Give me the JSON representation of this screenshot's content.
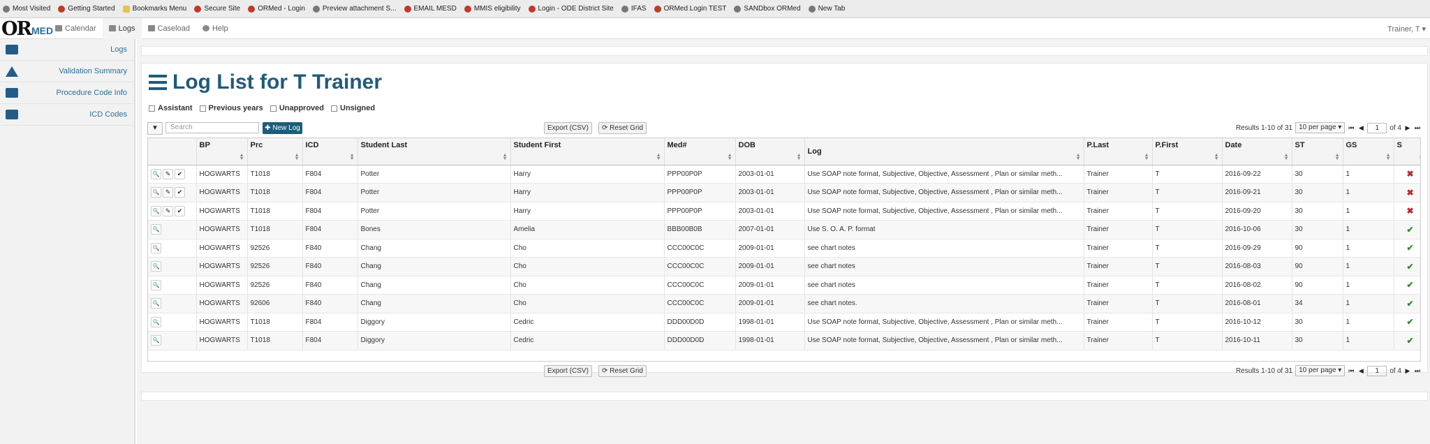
{
  "bookmarks": [
    {
      "label": "Most Visited",
      "icon": "gear-icon"
    },
    {
      "label": "Getting Started",
      "icon": "firefox-icon"
    },
    {
      "label": "Bookmarks Menu",
      "icon": "folder-icon"
    },
    {
      "label": "Secure Site",
      "icon": "site-icon"
    },
    {
      "label": "ORMed - Login",
      "icon": "site-icon"
    },
    {
      "label": "Preview attachment S...",
      "icon": "globe-icon"
    },
    {
      "label": "EMAIL MESD",
      "icon": "site-icon"
    },
    {
      "label": "MMIS eligibility",
      "icon": "site-icon"
    },
    {
      "label": "Login - ODE District Site",
      "icon": "site-icon"
    },
    {
      "label": "IFAS",
      "icon": "globe-icon"
    },
    {
      "label": "ORMed Login TEST",
      "icon": "site-icon"
    },
    {
      "label": "SANDbox ORMed",
      "icon": "globe-icon"
    },
    {
      "label": "New Tab",
      "icon": "globe-icon"
    }
  ],
  "nav": {
    "logo_or": "OR",
    "logo_med": "MED",
    "calendar": "Calendar",
    "logs": "Logs",
    "caseload": "Caseload",
    "help": "Help",
    "user": "Trainer, T ▾"
  },
  "sidebar": {
    "items": [
      {
        "label": "Logs",
        "icon": "list-icon"
      },
      {
        "label": "Validation Summary",
        "icon": "warning-icon"
      },
      {
        "label": "Procedure Code Info",
        "icon": "stack-icon"
      },
      {
        "label": "ICD Codes",
        "icon": "card-icon"
      }
    ]
  },
  "page": {
    "title": "Log List for T Trainer",
    "filters": [
      "Assistant",
      "Previous years",
      "Unapproved",
      "Unsigned"
    ],
    "search_placeholder": "Search",
    "new_log": "✚ New Log",
    "export": "Export (CSV)",
    "reset": "⟳ Reset Grid",
    "results": "Results 1-10  of 31",
    "per_page": "10 per page ▾",
    "page_num": "1",
    "of_pages": "of 4"
  },
  "table": {
    "columns": [
      "",
      "BP",
      "Prc",
      "ICD",
      "Student Last",
      "Student First",
      "Med#",
      "DOB",
      "Log",
      "P.Last",
      "P.First",
      "Date",
      "ST",
      "GS",
      "S"
    ],
    "rows": [
      {
        "actions": 3,
        "bp": "HOGWARTS",
        "prc": "T1018",
        "icd": "F804",
        "last": "Potter",
        "first": "Harry",
        "med": "PPP00P0P",
        "dob": "2003-01-01",
        "log": "Use SOAP note format, Subjective, Objective, Assessment , Plan or similar meth...",
        "plast": "Trainer",
        "pfirst": "T",
        "date": "2016-09-22",
        "st": "30",
        "gs": "1",
        "s": "x"
      },
      {
        "actions": 3,
        "bp": "HOGWARTS",
        "prc": "T1018",
        "icd": "F804",
        "last": "Potter",
        "first": "Harry",
        "med": "PPP00P0P",
        "dob": "2003-01-01",
        "log": "Use SOAP note format, Subjective, Objective, Assessment , Plan or similar meth...",
        "plast": "Trainer",
        "pfirst": "T",
        "date": "2016-09-21",
        "st": "30",
        "gs": "1",
        "s": "x"
      },
      {
        "actions": 3,
        "bp": "HOGWARTS",
        "prc": "T1018",
        "icd": "F804",
        "last": "Potter",
        "first": "Harry",
        "med": "PPP00P0P",
        "dob": "2003-01-01",
        "log": "Use SOAP note format, Subjective, Objective, Assessment , Plan or similar meth...",
        "plast": "Trainer",
        "pfirst": "T",
        "date": "2016-09-20",
        "st": "30",
        "gs": "1",
        "s": "x"
      },
      {
        "actions": 1,
        "bp": "HOGWARTS",
        "prc": "T1018",
        "icd": "F804",
        "last": "Bones",
        "first": "Amelia",
        "med": "BBB00B0B",
        "dob": "2007-01-01",
        "log": "Use S. O. A. P. format",
        "plast": "Trainer",
        "pfirst": "T",
        "date": "2016-10-06",
        "st": "30",
        "gs": "1",
        "s": "ok"
      },
      {
        "actions": 1,
        "bp": "HOGWARTS",
        "prc": "92526",
        "icd": "F840",
        "last": "Chang",
        "first": "Cho",
        "med": "CCC00C0C",
        "dob": "2009-01-01",
        "log": "see chart notes",
        "plast": "Trainer",
        "pfirst": "T",
        "date": "2016-09-29",
        "st": "90",
        "gs": "1",
        "s": "ok"
      },
      {
        "actions": 1,
        "bp": "HOGWARTS",
        "prc": "92526",
        "icd": "F840",
        "last": "Chang",
        "first": "Cho",
        "med": "CCC00C0C",
        "dob": "2009-01-01",
        "log": "see chart notes",
        "plast": "Trainer",
        "pfirst": "T",
        "date": "2016-08-03",
        "st": "90",
        "gs": "1",
        "s": "ok"
      },
      {
        "actions": 1,
        "bp": "HOGWARTS",
        "prc": "92526",
        "icd": "F840",
        "last": "Chang",
        "first": "Cho",
        "med": "CCC00C0C",
        "dob": "2009-01-01",
        "log": "see chart notes",
        "plast": "Trainer",
        "pfirst": "T",
        "date": "2016-08-02",
        "st": "90",
        "gs": "1",
        "s": "ok"
      },
      {
        "actions": 1,
        "bp": "HOGWARTS",
        "prc": "92606",
        "icd": "F840",
        "last": "Chang",
        "first": "Cho",
        "med": "CCC00C0C",
        "dob": "2009-01-01",
        "log": "see chart notes.",
        "plast": "Trainer",
        "pfirst": "T",
        "date": "2016-08-01",
        "st": "34",
        "gs": "1",
        "s": "ok"
      },
      {
        "actions": 1,
        "bp": "HOGWARTS",
        "prc": "T1018",
        "icd": "F804",
        "last": "Diggory",
        "first": "Cedric",
        "med": "DDD00D0D",
        "dob": "1998-01-01",
        "log": "Use SOAP note format, Subjective, Objective, Assessment , Plan or similar meth...",
        "plast": "Trainer",
        "pfirst": "T",
        "date": "2016-10-12",
        "st": "30",
        "gs": "1",
        "s": "ok"
      },
      {
        "actions": 1,
        "bp": "HOGWARTS",
        "prc": "T1018",
        "icd": "F804",
        "last": "Diggory",
        "first": "Cedric",
        "med": "DDD00D0D",
        "dob": "1998-01-01",
        "log": "Use SOAP note format, Subjective, Objective, Assessment , Plan or similar meth...",
        "plast": "Trainer",
        "pfirst": "T",
        "date": "2016-10-11",
        "st": "30",
        "gs": "1",
        "s": "ok"
      }
    ]
  },
  "colors": {
    "accent": "#1f5b7c",
    "error": "#c0262c",
    "ok": "#2e8b2e"
  }
}
